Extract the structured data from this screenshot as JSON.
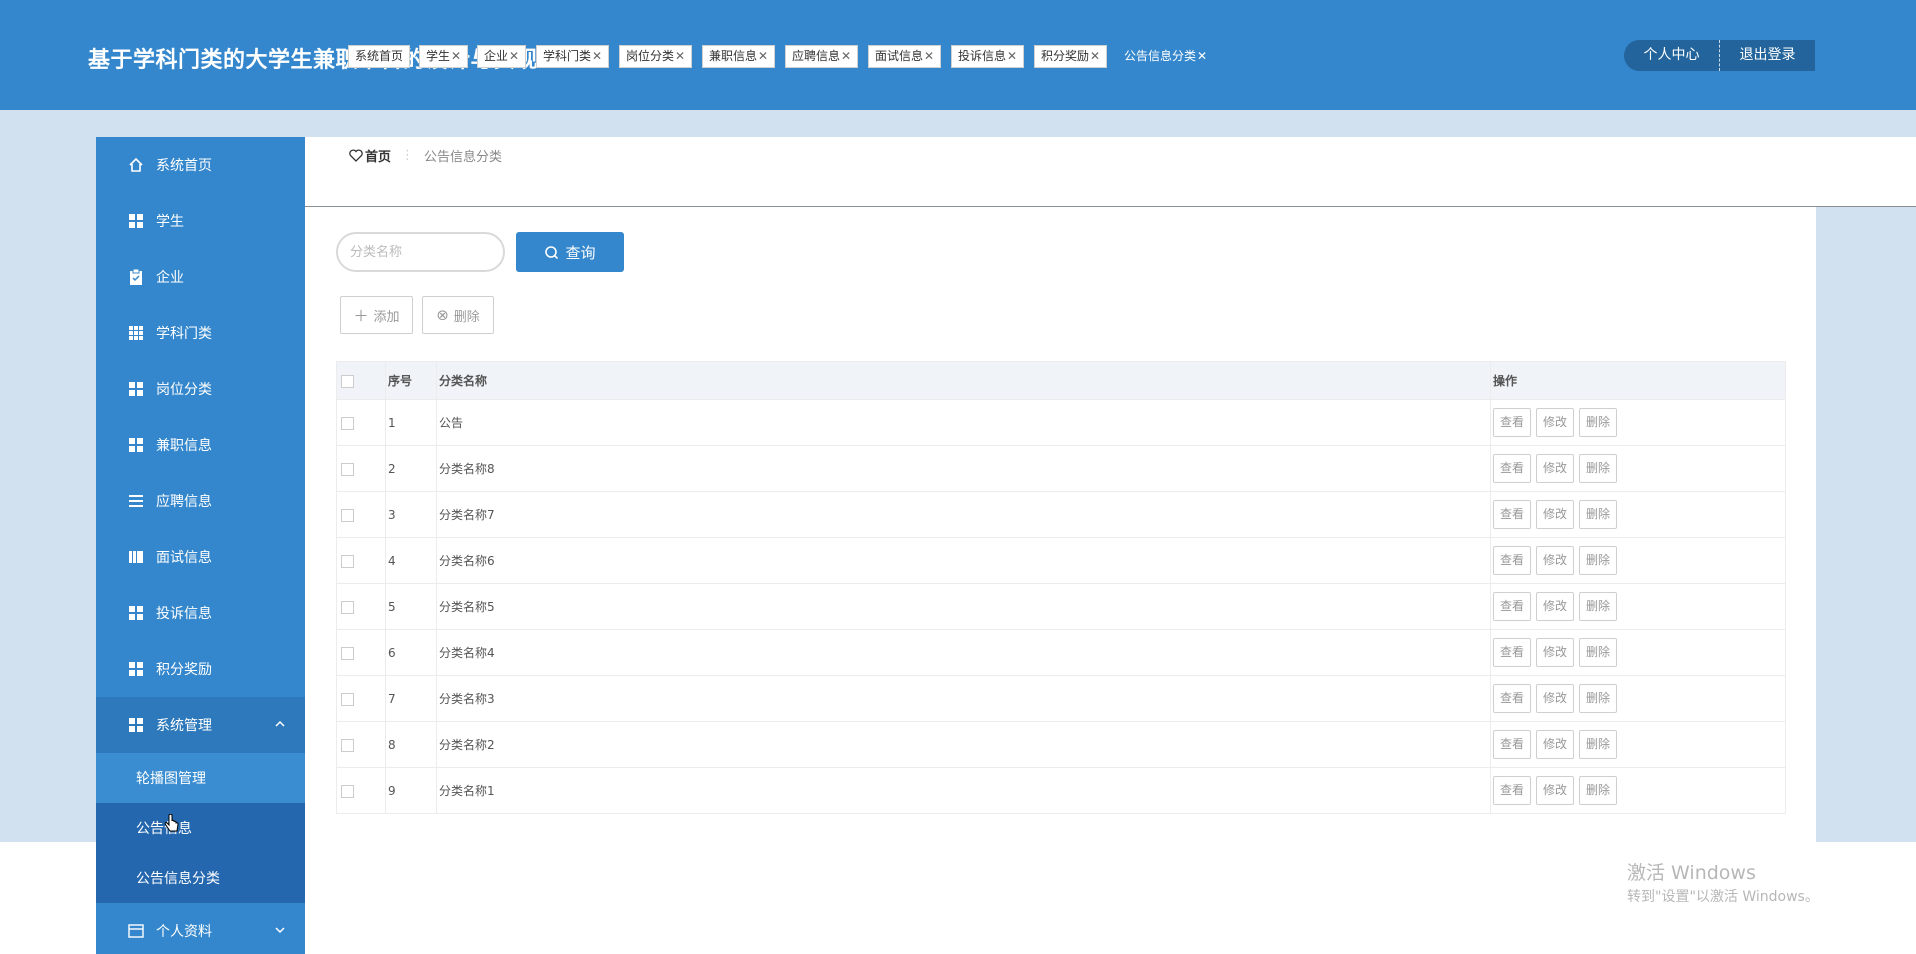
{
  "header": {
    "title": "基于学科门类的大学生兼职平台的设计与实现",
    "personal_center": "个人中心",
    "logout": "退出登录"
  },
  "sidebar": {
    "items": [
      {
        "label": "系统首页",
        "icon": "home-icon"
      },
      {
        "label": "学生",
        "icon": "grid-icon"
      },
      {
        "label": "企业",
        "icon": "clipboard-icon"
      },
      {
        "label": "学科门类",
        "icon": "grid-nine-icon"
      },
      {
        "label": "岗位分类",
        "icon": "grid-icon"
      },
      {
        "label": "兼职信息",
        "icon": "grid-icon"
      },
      {
        "label": "应聘信息",
        "icon": "list-icon"
      },
      {
        "label": "面试信息",
        "icon": "book-icon"
      },
      {
        "label": "投诉信息",
        "icon": "grid-icon"
      },
      {
        "label": "积分奖励",
        "icon": "grid-icon"
      },
      {
        "label": "系统管理",
        "icon": "grid-icon"
      }
    ],
    "sub_items": [
      {
        "label": "轮播图管理"
      },
      {
        "label": "公告信息"
      },
      {
        "label": "公告信息分类"
      }
    ],
    "profile": {
      "label": "个人资料",
      "icon": "card-icon"
    }
  },
  "breadcrumb": {
    "home": "首页",
    "current": "公告信息分类"
  },
  "tabs": [
    {
      "label": "系统首页",
      "closable": false
    },
    {
      "label": "学生",
      "closable": true
    },
    {
      "label": "企业",
      "closable": true
    },
    {
      "label": "学科门类",
      "closable": true
    },
    {
      "label": "岗位分类",
      "closable": true
    },
    {
      "label": "兼职信息",
      "closable": true
    },
    {
      "label": "应聘信息",
      "closable": true
    },
    {
      "label": "面试信息",
      "closable": true
    },
    {
      "label": "投诉信息",
      "closable": true
    },
    {
      "label": "积分奖励",
      "closable": true
    },
    {
      "label": "公告信息分类",
      "closable": true,
      "active": true
    }
  ],
  "search": {
    "placeholder": "分类名称",
    "button": "查询"
  },
  "actions": {
    "add": "添加",
    "delete": "删除"
  },
  "table": {
    "headers": {
      "index": "序号",
      "name": "分类名称",
      "ops": "操作"
    },
    "rows": [
      {
        "index": "1",
        "name": "公告"
      },
      {
        "index": "2",
        "name": "分类名称8"
      },
      {
        "index": "3",
        "name": "分类名称7"
      },
      {
        "index": "4",
        "name": "分类名称6"
      },
      {
        "index": "5",
        "name": "分类名称5"
      },
      {
        "index": "6",
        "name": "分类名称4"
      },
      {
        "index": "7",
        "name": "分类名称3"
      },
      {
        "index": "8",
        "name": "分类名称2"
      },
      {
        "index": "9",
        "name": "分类名称1"
      }
    ],
    "row_buttons": {
      "view": "查看",
      "edit": "修改",
      "delete": "删除"
    }
  },
  "watermark": {
    "line1": "激活 Windows",
    "line2": "转到\"设置\"以激活 Windows。"
  },
  "colors": {
    "primary": "#3487cc",
    "sidebar_active": "#2467ae",
    "backdrop": "#d2e1ef"
  }
}
